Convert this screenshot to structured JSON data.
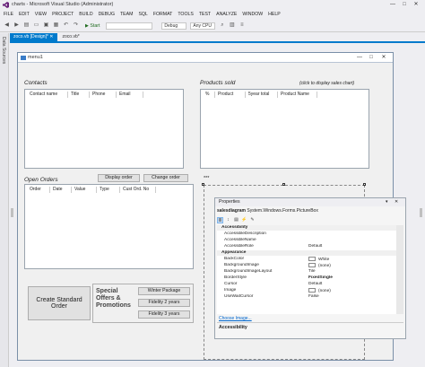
{
  "window": {
    "title": "charts - Microsoft Visual Studio (Administrator)",
    "controls": [
      "—",
      "□",
      "✕"
    ]
  },
  "menu": [
    "FILE",
    "EDIT",
    "VIEW",
    "PROJECT",
    "BUILD",
    "DEBUG",
    "TEAM",
    "SQL",
    "FORMAT",
    "TOOLS",
    "TEST",
    "ANALYZE",
    "WINDOW",
    "HELP"
  ],
  "toolbar": {
    "start_label": "▶ Start",
    "config": "Debug",
    "platform": "Any CPU"
  },
  "left_strip": {
    "label": "Data Sources"
  },
  "tabs": [
    {
      "label": "zoco.vb [Design]*",
      "active": true
    },
    {
      "label": "zoco.vb*",
      "active": false
    }
  ],
  "form": {
    "title": "menu1",
    "contacts": {
      "label": "Contacts",
      "columns": [
        "Contact name",
        "Title",
        "Phone",
        "Email"
      ]
    },
    "products": {
      "label": "Products sold",
      "hint": "(click to display sales chart)",
      "columns": [
        "%",
        "Product",
        "5year total",
        "Product Name"
      ]
    },
    "orders": {
      "label": "Open Orders",
      "display_button": "Display order",
      "change_button": "Change order",
      "columns": [
        "Order",
        "Date",
        "Value",
        "Type",
        "Cust Ord. No"
      ]
    },
    "picture_marker": "***",
    "create_button": "Create Standard Order",
    "special": {
      "label_line1": "Special",
      "label_line2": "Offers &",
      "label_line3": "Promotions",
      "buttons": [
        "Winter Package",
        "Fidelity 2 years",
        "Fidelity 3 years"
      ]
    }
  },
  "properties": {
    "title": "Properties",
    "object_name": "salesdiagram",
    "object_type": "System.Windows.Forms.PictureBox",
    "rows": [
      {
        "kind": "cat",
        "name": "Accessibility",
        "value": ""
      },
      {
        "kind": "prop",
        "name": "AccessibleDescription",
        "value": ""
      },
      {
        "kind": "prop",
        "name": "AccessibleName",
        "value": ""
      },
      {
        "kind": "prop",
        "name": "AccessibleRole",
        "value": "Default"
      },
      {
        "kind": "cat",
        "name": "Appearance",
        "value": ""
      },
      {
        "kind": "prop",
        "name": "BackColor",
        "value": "White",
        "swatch": true
      },
      {
        "kind": "prop",
        "name": "BackgroundImage",
        "value": "(none)",
        "swatch": true
      },
      {
        "kind": "prop",
        "name": "BackgroundImageLayout",
        "value": "Tile"
      },
      {
        "kind": "prop",
        "name": "BorderStyle",
        "value": "FixedSingle",
        "bold": true
      },
      {
        "kind": "prop",
        "name": "Cursor",
        "value": "Default"
      },
      {
        "kind": "prop",
        "name": "Image",
        "value": "(none)",
        "swatch": true
      },
      {
        "kind": "prop",
        "name": "UseWaitCursor",
        "value": "False"
      }
    ],
    "link": "Choose Image...",
    "description": "Accessibility"
  }
}
